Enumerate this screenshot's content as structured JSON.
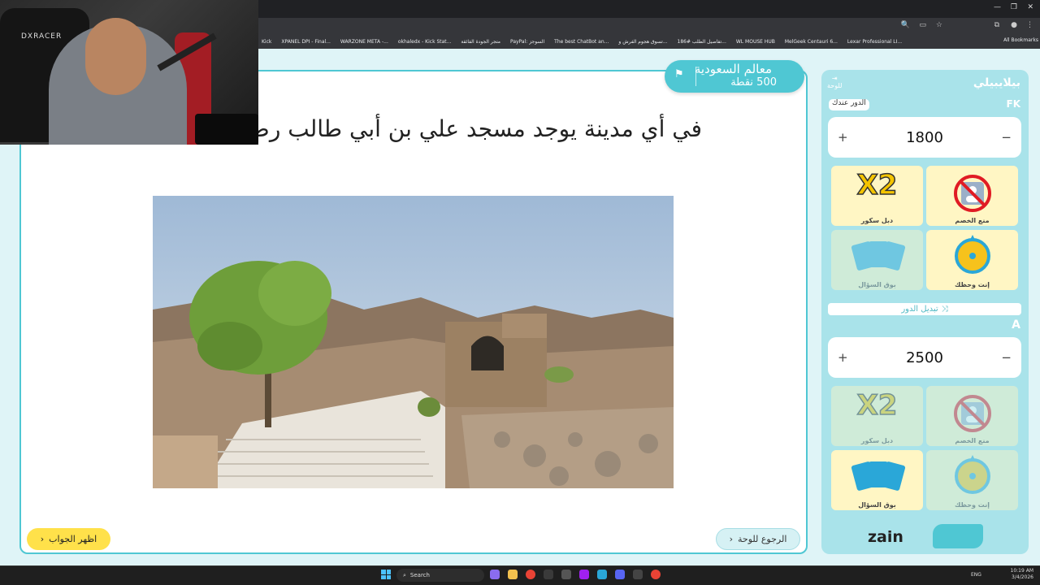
{
  "webcam": {
    "chair_brand": "DXRACER"
  },
  "browser": {
    "bookmarks": [
      "Kick",
      "XPANEL DPI - Final...",
      "WARZONE META -...",
      "okhaledx - Kick Stat...",
      "متجر الجودة الفائقة",
      "PayPal: السوجز",
      "The best ChatBot an...",
      "تسوق هجوم الفرش و...",
      "تفاصيل الطلب #186...",
      "WL MOUSE HUB",
      "MelGeek Centauri 6...",
      "Lexar Professional LI..."
    ],
    "all_bookmarks": "All Bookmarks"
  },
  "category": {
    "name": "معالم السعودية",
    "points": "500 نقطة",
    "icon": "flag-icon"
  },
  "question": {
    "text": "في أي مدينة يوجد مسجد علي بن أبي طالب رضي"
  },
  "buttons": {
    "show_answer": "اظهر الجواب",
    "back_to_board": "الرجوع للوحة"
  },
  "sidebar": {
    "board_link": "للوحة",
    "team1": {
      "name": "بيلايبيلي",
      "turn_label": "الدور عندك",
      "short": "FK",
      "score": "1800",
      "plus": "+",
      "minus": "−"
    },
    "team2": {
      "name": "A",
      "score": "2500",
      "plus": "+",
      "minus": "−"
    },
    "tools": {
      "double": "دبل سكور",
      "block": "منع الخصم",
      "trumpet": "بوق السؤال",
      "spin": "إنت وحظك"
    },
    "swap_turn": "تبديل الدور",
    "sponsor": "zain"
  },
  "taskbar": {
    "search": "Search",
    "lang": "ENG",
    "time": "10:19 AM",
    "date": "3/4/2026"
  },
  "colors": {
    "accent": "#4fc7d3",
    "answer_btn": "#ffe14a",
    "sidebar": "#a9e3ea"
  }
}
